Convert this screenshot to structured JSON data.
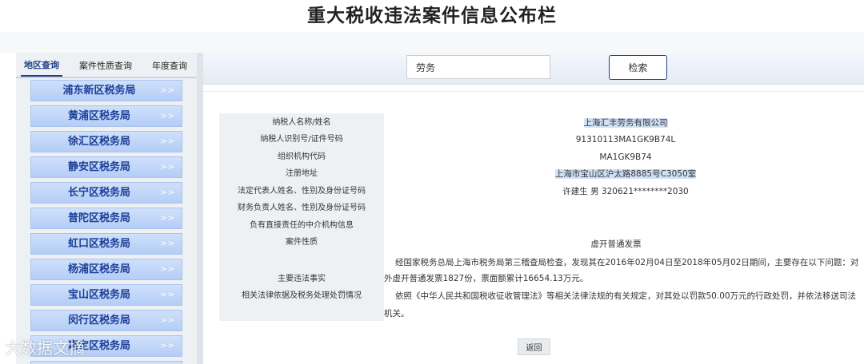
{
  "page": {
    "title": "重大税收违法案件信息公布栏"
  },
  "tabs": [
    {
      "label": "地区查询",
      "active": true
    },
    {
      "label": "案件性质查询",
      "active": false
    },
    {
      "label": "年度查询",
      "active": false
    }
  ],
  "districts": [
    {
      "name": "浦东新区税务局",
      "arrow": ">>"
    },
    {
      "name": "黄浦区税务局",
      "arrow": ">>"
    },
    {
      "name": "徐汇区税务局",
      "arrow": ">>"
    },
    {
      "name": "静安区税务局",
      "arrow": ">>"
    },
    {
      "name": "长宁区税务局",
      "arrow": ">>"
    },
    {
      "name": "普陀区税务局",
      "arrow": ">>"
    },
    {
      "name": "虹口区税务局",
      "arrow": ">>"
    },
    {
      "name": "杨浦区税务局",
      "arrow": ">>"
    },
    {
      "name": "宝山区税务局",
      "arrow": ">>"
    },
    {
      "name": "闵行区税务局",
      "arrow": ">>"
    },
    {
      "name": "嘉定区税务局",
      "arrow": ">>"
    }
  ],
  "search": {
    "value": "劳务",
    "button_label": "检索"
  },
  "case": {
    "labels": [
      "纳税人名称/姓名",
      "纳税人识别号/证件号码",
      "组织机构代码",
      "注册地址",
      "法定代表人姓名、性别及身份证号码",
      "财务负责人姓名、性别及身份证号码",
      "负有直接责任的中介机构信息",
      "案件性质",
      "主要违法事实",
      "相关法律依据及税务处理处罚情况"
    ],
    "values": {
      "taxpayer_name": "上海汇丰劳务有限公司",
      "taxpayer_id": "91310113MA1GK9B74L",
      "org_code": "MA1GK9B74",
      "address": "上海市宝山区沪太路8885号C3050室",
      "legal_rep": "许建生  男  320621********2030",
      "case_nature": "虚开普通发票",
      "facts": "经国家税务总局上海市税务局第三稽查局检查，发现其在2016年02月04日至2018年05月02日期间，主要存在以下问题：对外虚开普通发票1827份，票面额累计16654.13万元。",
      "penalty": "依照《中华人民共和国税收征收管理法》等相关法律法规的有关规定，对其处以罚款50.00万元的行政处罚，并依法移送司法机关。"
    }
  },
  "back_label": "返回",
  "watermark": "大数据文摘"
}
